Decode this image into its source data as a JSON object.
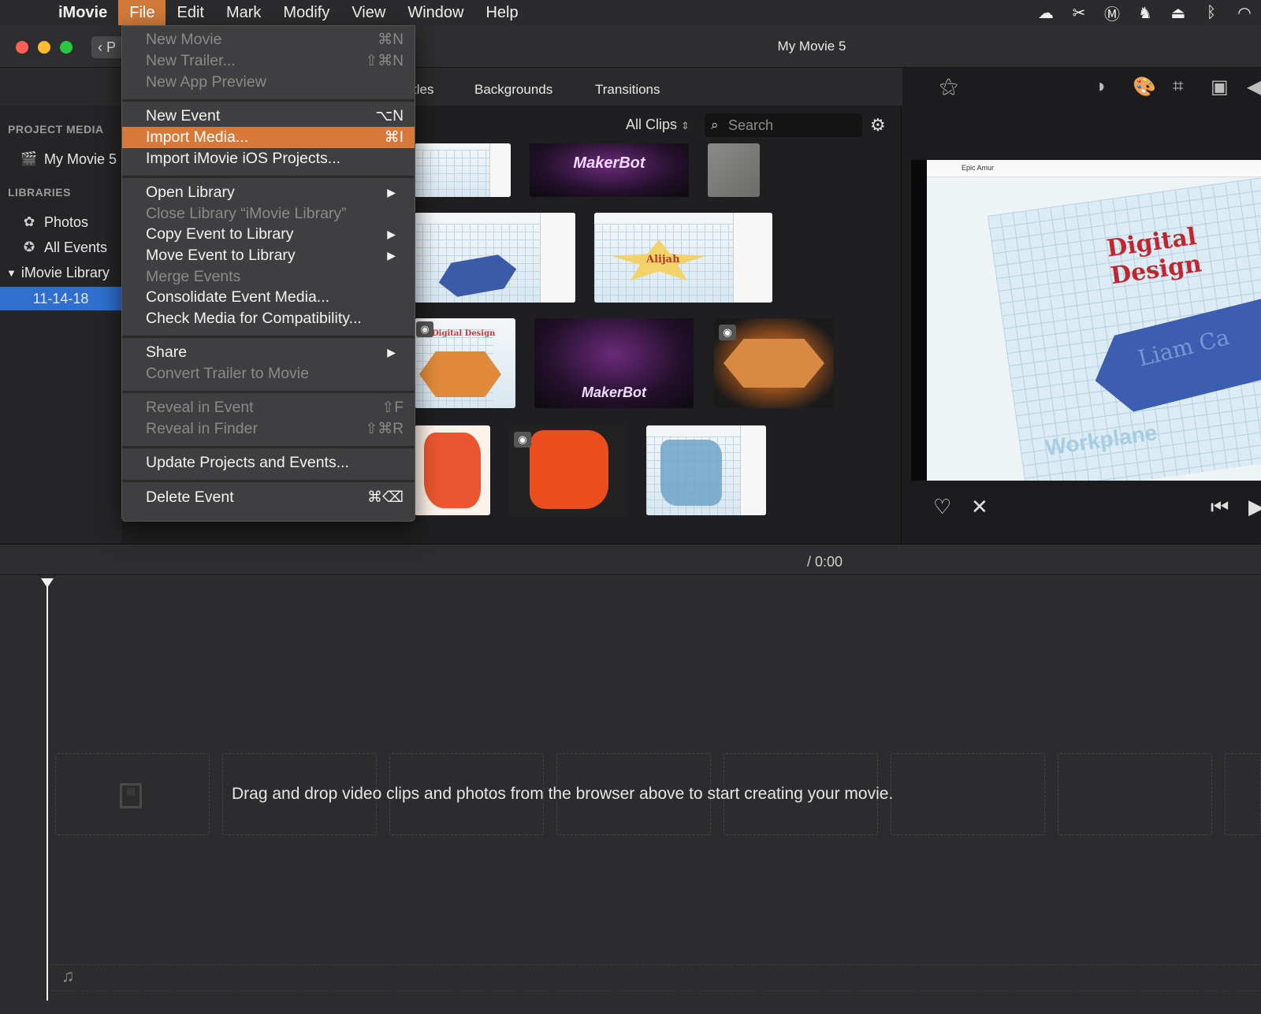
{
  "menubar": {
    "app_name": "iMovie",
    "items": [
      "File",
      "Edit",
      "Mark",
      "Modify",
      "View",
      "Window",
      "Help"
    ]
  },
  "window": {
    "title": "My Movie 5",
    "back_label": "P"
  },
  "browser": {
    "tabs": [
      "tles",
      "Backgrounds",
      "Transitions"
    ],
    "filter_label": "All Clips",
    "search_placeholder": "Search",
    "thumb_texts": {
      "makerbot1": "MakerBot",
      "alijah": "Alijah",
      "digital_small": "Digital Design",
      "makerbot2": "MakerBot"
    }
  },
  "sidebar": {
    "project_media_heading": "PROJECT MEDIA",
    "project_item": "My Movie 5",
    "libraries_heading": "LIBRARIES",
    "photos": "Photos",
    "all_events": "All Events",
    "library_name": "iMovie Library",
    "event_selected": "11-14-18"
  },
  "viewer": {
    "preview_header": "Epic Amur",
    "preview_title": "Digital Design",
    "preview_workplane": "Workplane",
    "preview_hex_text": "Liam Ca"
  },
  "timeline": {
    "timecode": "/  0:00",
    "drop_message": "Drag and drop video clips and photos from the browser above to start creating your movie."
  },
  "file_menu": {
    "items": [
      {
        "label": "New Movie",
        "shortcut": "⌘N",
        "disabled": true
      },
      {
        "label": "New Trailer...",
        "shortcut": "⇧⌘N",
        "disabled": true
      },
      {
        "label": "New App Preview",
        "shortcut": "",
        "disabled": true
      },
      {
        "label": "New Event",
        "shortcut": "⌥N",
        "disabled": false
      },
      {
        "label": "Import Media...",
        "shortcut": "⌘I",
        "disabled": false,
        "highlight": true
      },
      {
        "label": "Import iMovie iOS Projects...",
        "shortcut": "",
        "disabled": false
      },
      {
        "label": "Open Library",
        "shortcut": "",
        "disabled": false,
        "submenu": true
      },
      {
        "label": "Close Library “iMovie Library”",
        "shortcut": "",
        "disabled": true
      },
      {
        "label": "Copy Event to Library",
        "shortcut": "",
        "disabled": false,
        "submenu": true
      },
      {
        "label": "Move Event to Library",
        "shortcut": "",
        "disabled": false,
        "submenu": true
      },
      {
        "label": "Merge Events",
        "shortcut": "",
        "disabled": true
      },
      {
        "label": "Consolidate Event Media...",
        "shortcut": "",
        "disabled": false
      },
      {
        "label": "Check Media for Compatibility...",
        "shortcut": "",
        "disabled": false
      },
      {
        "label": "Share",
        "shortcut": "",
        "disabled": false,
        "submenu": true
      },
      {
        "label": "Convert Trailer to Movie",
        "shortcut": "",
        "disabled": true
      },
      {
        "label": "Reveal in Event",
        "shortcut": "⇧F",
        "disabled": true
      },
      {
        "label": "Reveal in Finder",
        "shortcut": "⇧⌘R",
        "disabled": true
      },
      {
        "label": "Update Projects and Events...",
        "shortcut": "",
        "disabled": false
      },
      {
        "label": "Delete Event",
        "shortcut": "⌘⌫",
        "disabled": false
      }
    ]
  },
  "icons": {
    "apple": "apple-icon",
    "status": [
      "creative-cloud-icon",
      "scissors-icon",
      "malwarebytes-icon",
      "evernote-icon",
      "airplay-icon",
      "bluetooth-icon",
      "wifi-icon"
    ],
    "viewer_tools": [
      "magic-wand-icon",
      "color-balance-icon",
      "palette-icon",
      "crop-icon",
      "camera-stabilize-icon",
      "volume-icon"
    ]
  },
  "colors": {
    "menu_highlight": "#d6793a",
    "sidebar_selected": "#2f6fd0"
  }
}
